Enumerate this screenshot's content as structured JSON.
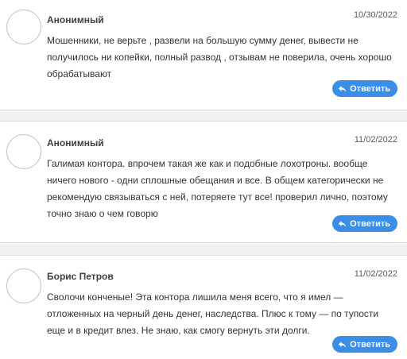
{
  "comments": [
    {
      "author": "Анонимный",
      "date": "10/30/2022",
      "text": "Мошенники, не верьте , развели на большую сумму денег, вывести не получилось ни копейки, полный развод , отзывам не поверила, очень хорошо обрабатывают",
      "reply_label": "Ответить"
    },
    {
      "author": "Анонимный",
      "date": "11/02/2022",
      "text": "Галимая контора. впрочем такая же как и подобные лохотроны. вообще ничего нового - одни сплошные обещания и все. В общем категорически не рекомендую связываться с ней, потеряете тут все! проверил лично, поэтому точно знаю о чем говорю",
      "reply_label": "Ответить"
    },
    {
      "author": "Борис Петров",
      "date": "11/02/2022",
      "text": "Сволочи конченые! Эта контора лишила меня всего, что я имел — отложенных на черный день денег, наследства. Плюс к тому — по тупости еще и в кредит влез. Не знаю, как смогу вернуть эти долги.",
      "reply_label": "Ответить"
    }
  ],
  "icons": {
    "reply": "reply-arrow-icon",
    "avatar": "avatar-placeholder"
  },
  "colors": {
    "accent": "#3b8ee8",
    "separator": "#f0f1f3"
  }
}
